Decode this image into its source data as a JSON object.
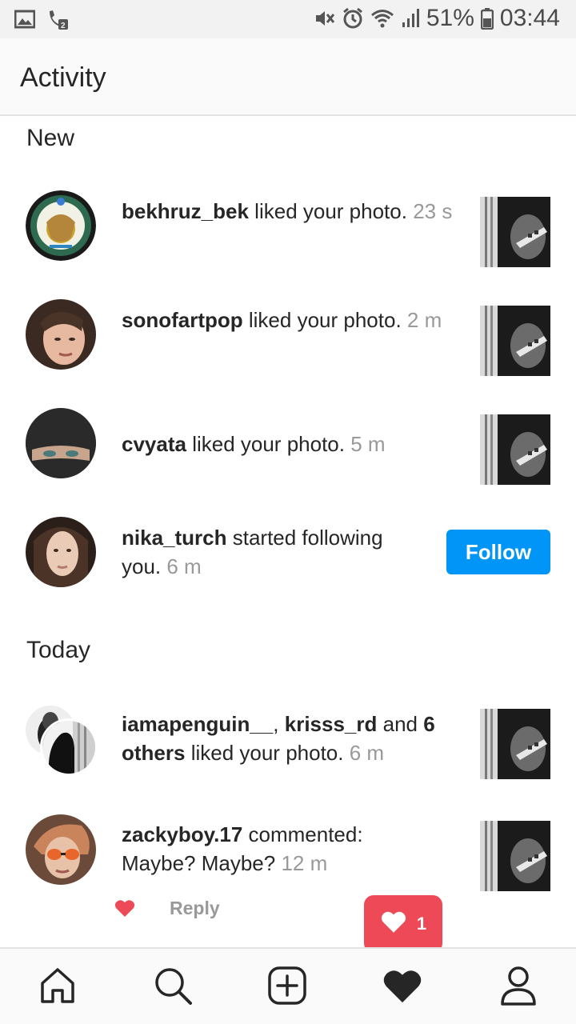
{
  "status_bar": {
    "battery": "51%",
    "time": "03:44"
  },
  "header": {
    "title": "Activity"
  },
  "sections": {
    "new_title": "New",
    "today_title": "Today"
  },
  "new_items": [
    {
      "user": "bekhruz_bek",
      "text": " liked your photo. ",
      "time": "23 s"
    },
    {
      "user": "sonofartpop",
      "text": " liked your photo. ",
      "time": "2 m"
    },
    {
      "user": "cvyata",
      "text": " liked your photo. ",
      "time": "5 m"
    },
    {
      "user": "nika_turch",
      "text": " started following you. ",
      "time": "6 m",
      "action": "Follow"
    }
  ],
  "today_items": [
    {
      "user1": "iamapenguin__",
      "sep1": ", ",
      "user2": "krisss_rd",
      "sep2": " and ",
      "others": "6 others",
      "text": " liked your photo. ",
      "time": "6 m"
    },
    {
      "user": "zackyboy.17",
      "text": " commented: Maybe? Maybe? ",
      "time": "12 m"
    }
  ],
  "reply": {
    "label": "Reply"
  },
  "notification": {
    "count": "1"
  },
  "nav": [
    "home-icon",
    "search-icon",
    "add-icon",
    "activity-heart-icon",
    "profile-icon"
  ],
  "colors": {
    "accent_blue": "#0095f6",
    "like_red": "#ed4956",
    "timestamp_gray": "#999999"
  }
}
